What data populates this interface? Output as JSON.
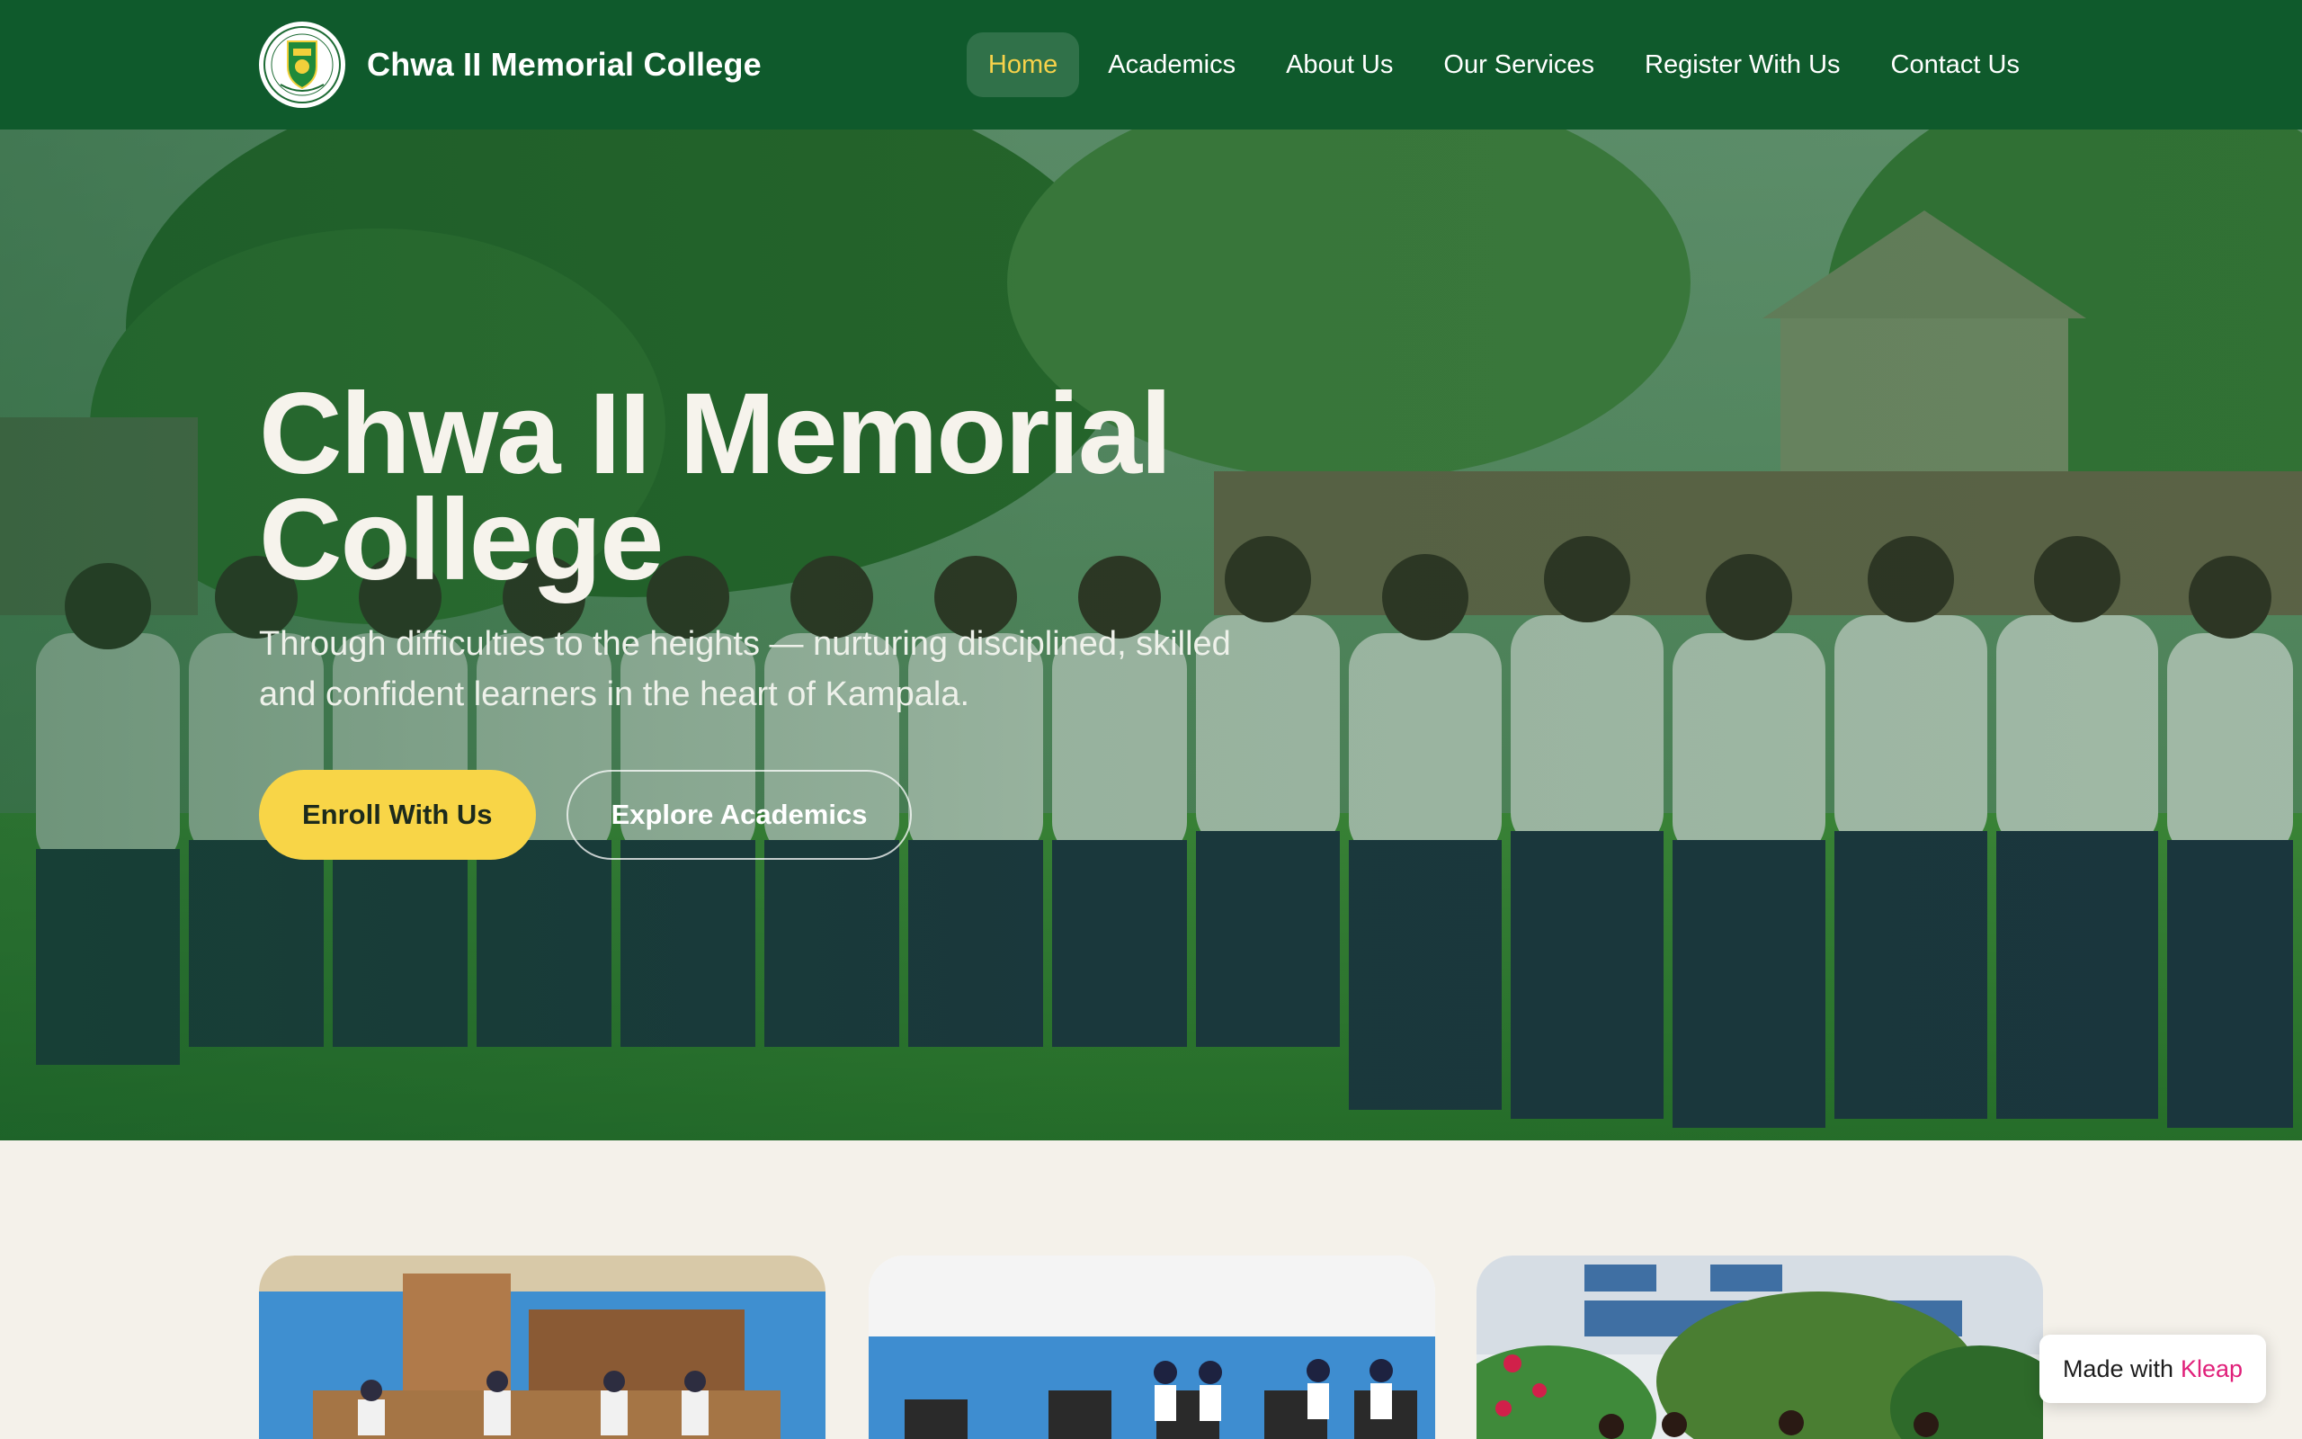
{
  "header": {
    "brand_name": "Chwa II Memorial College",
    "logo_icon": "school-crest-icon",
    "nav": [
      {
        "label": "Home",
        "active": true
      },
      {
        "label": "Academics",
        "active": false
      },
      {
        "label": "About Us",
        "active": false
      },
      {
        "label": "Our Services",
        "active": false
      },
      {
        "label": "Register With Us",
        "active": false
      },
      {
        "label": "Contact Us",
        "active": false
      }
    ]
  },
  "hero": {
    "title_line1": "Chwa II Memorial",
    "title_line2": "College",
    "subtitle": "Through difficulties to the heights — nurturing disciplined, skilled and confident learners in the heart of Kampala.",
    "primary_button": "Enroll With Us",
    "secondary_button": "Explore Academics"
  },
  "cards": [
    {
      "image": "classroom-photo"
    },
    {
      "image": "computer-lab-photo"
    },
    {
      "image": "campus-garden-photo"
    }
  ],
  "badge": {
    "prefix": "Made with",
    "brand": "Kleap"
  },
  "colors": {
    "nav_bg": "#0f5a2c",
    "accent_yellow": "#f8d547",
    "page_bg": "#f4f1ea",
    "kleap_pink": "#e0207a"
  }
}
